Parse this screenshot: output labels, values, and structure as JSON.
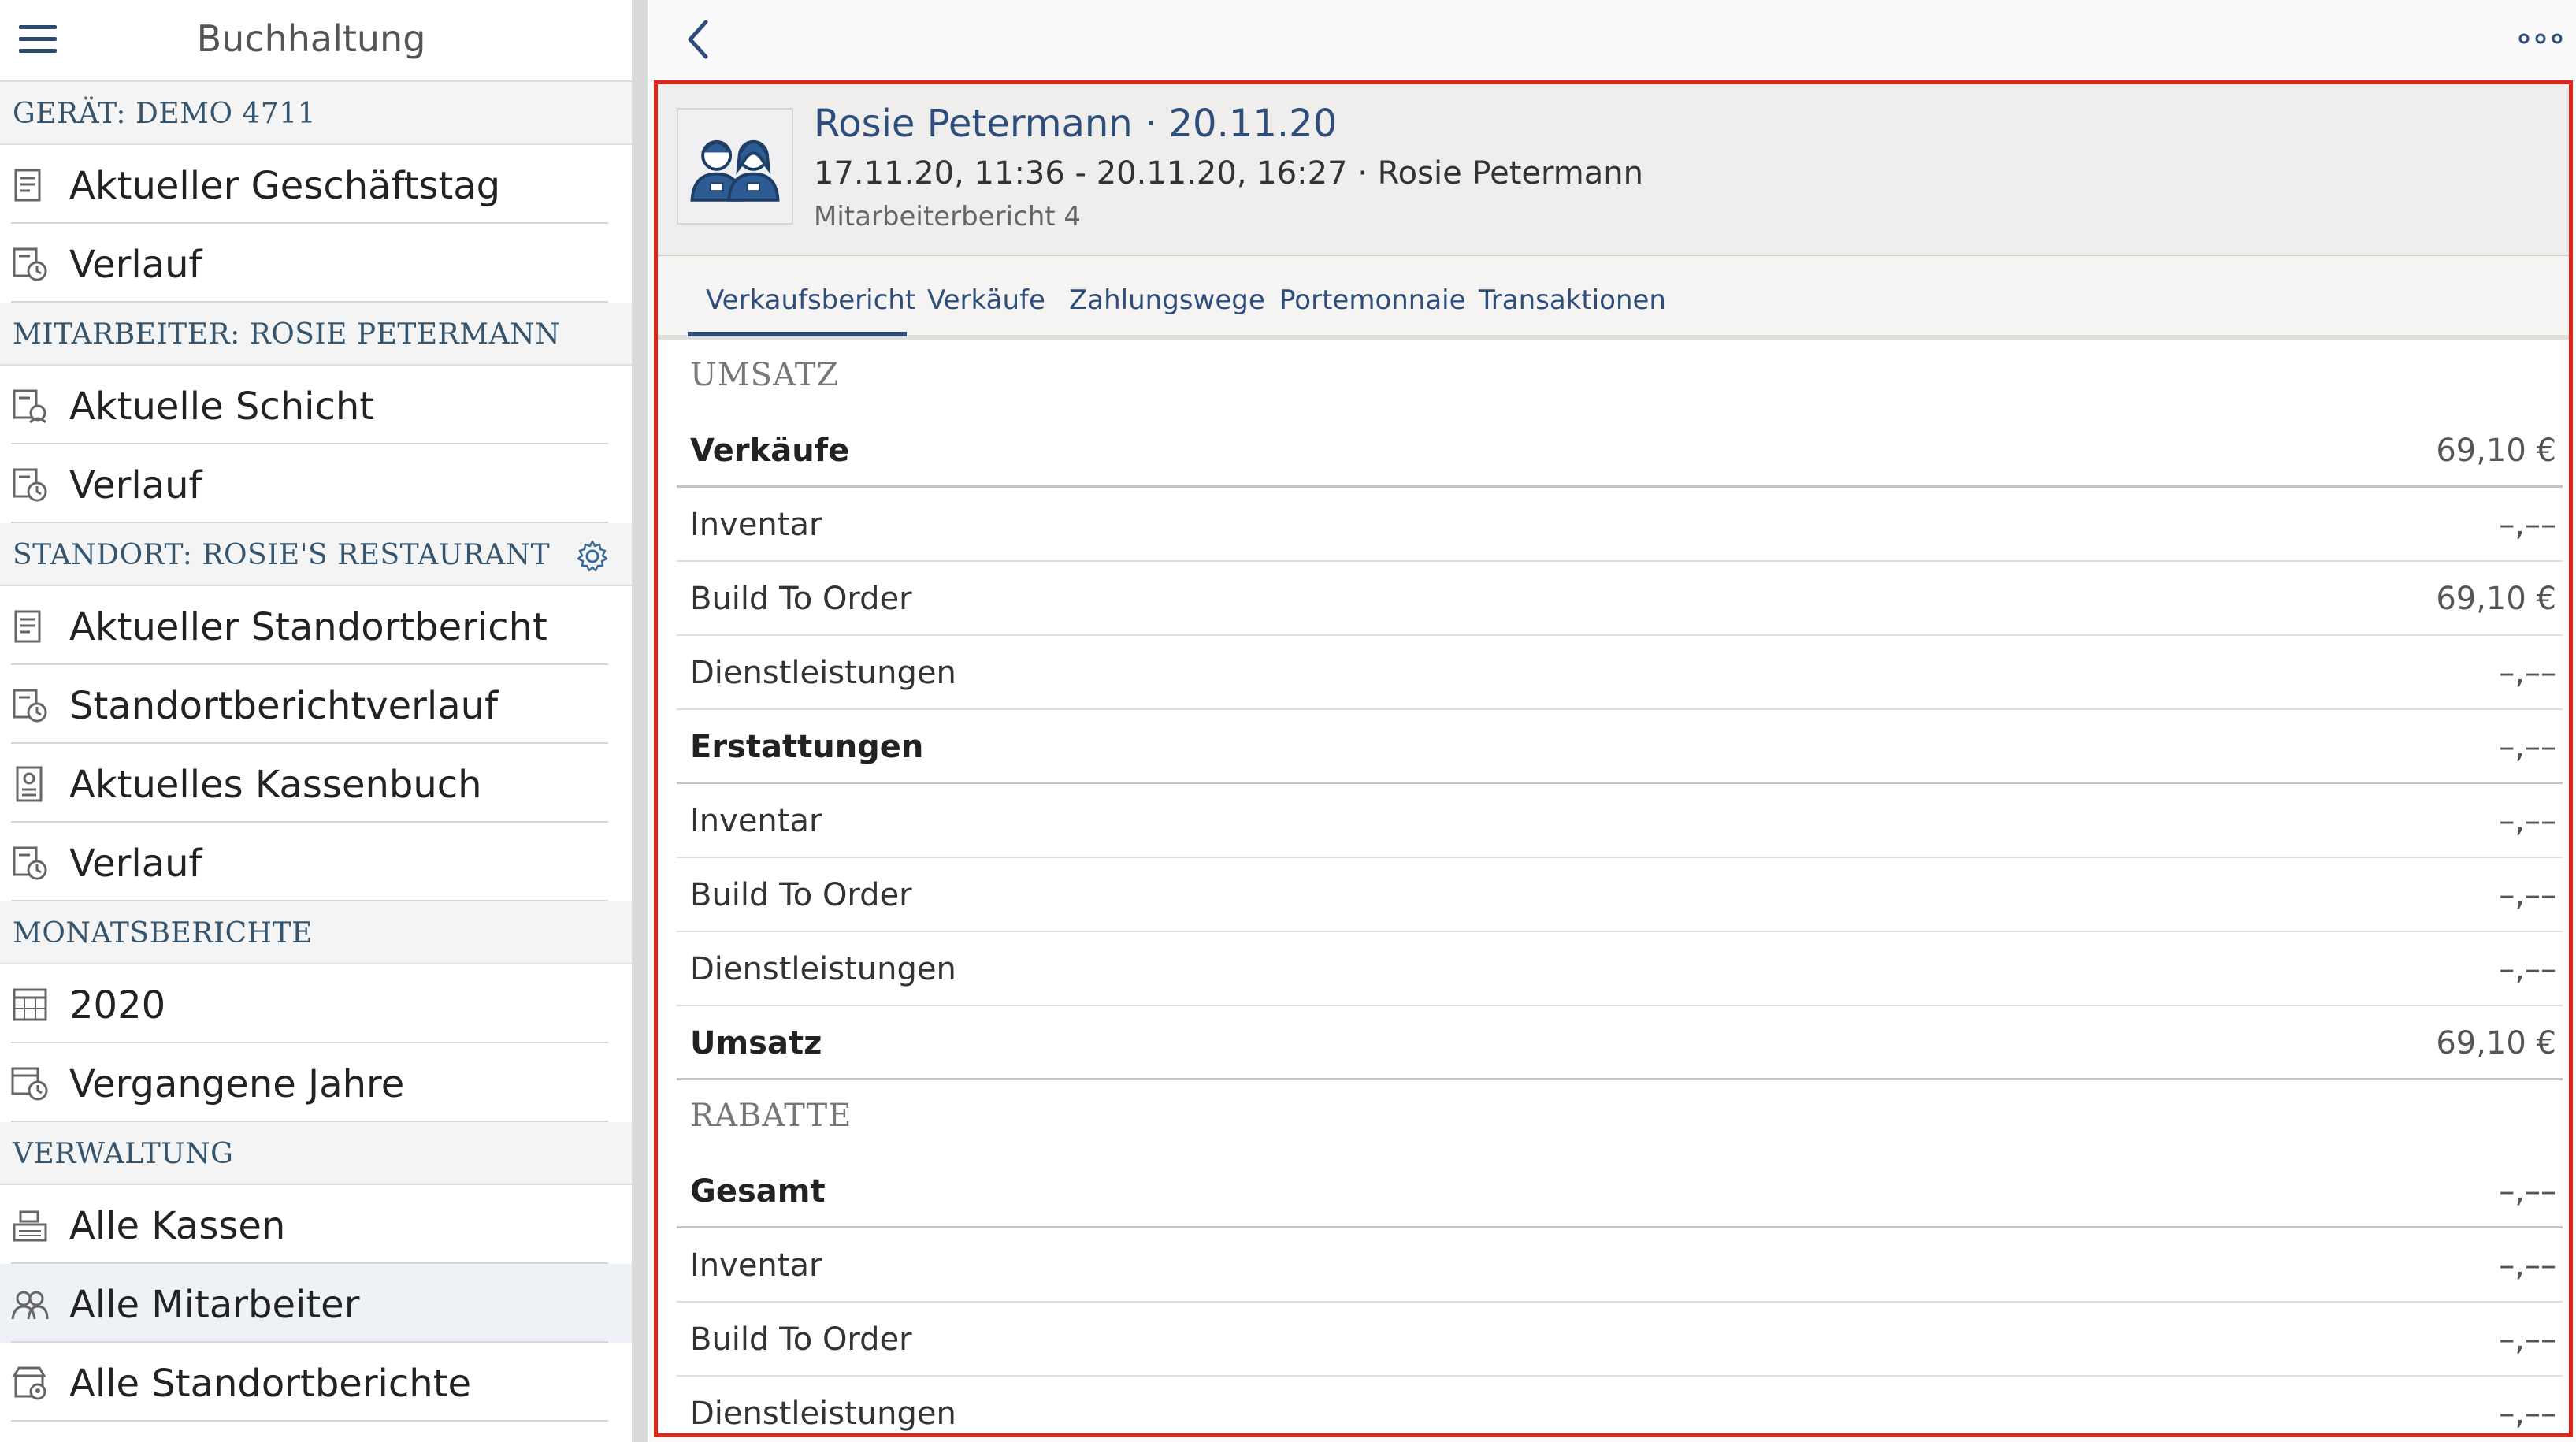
{
  "sidebar": {
    "title": "Buchhaltung",
    "sections": [
      {
        "label": "GERÄT: DEMO 4711",
        "gear": false,
        "items": [
          {
            "label": "Aktueller Geschäftstag",
            "icon": "receipt-icon",
            "active": false
          },
          {
            "label": "Verlauf",
            "icon": "history-receipt-icon",
            "active": false
          }
        ]
      },
      {
        "label": "MITARBEITER: ROSIE PETERMANN",
        "gear": false,
        "items": [
          {
            "label": "Aktuelle Schicht",
            "icon": "shift-receipt-icon",
            "active": false
          },
          {
            "label": "Verlauf",
            "icon": "history-receipt-icon",
            "active": false
          }
        ]
      },
      {
        "label": "STANDORT: ROSIE'S RESTAURANT",
        "gear": true,
        "items": [
          {
            "label": "Aktueller Standortbericht",
            "icon": "receipt-icon",
            "active": false
          },
          {
            "label": "Standortberichtverlauf",
            "icon": "history-receipt-icon",
            "active": false
          },
          {
            "label": "Aktuelles Kassenbuch",
            "icon": "cashbook-icon",
            "active": false
          },
          {
            "label": "Verlauf",
            "icon": "history-receipt-icon",
            "active": false
          }
        ]
      },
      {
        "label": "MONATSBERICHTE",
        "gear": false,
        "items": [
          {
            "label": "2020",
            "icon": "calendar-icon",
            "active": false
          },
          {
            "label": "Vergangene Jahre",
            "icon": "history-calendar-icon",
            "active": false
          }
        ]
      },
      {
        "label": "VERWALTUNG",
        "gear": false,
        "items": [
          {
            "label": "Alle Kassen",
            "icon": "cash-register-icon",
            "active": false
          },
          {
            "label": "Alle Mitarbeiter",
            "icon": "employees-icon",
            "active": true
          },
          {
            "label": "Alle Standortberichte",
            "icon": "store-location-icon",
            "active": false
          }
        ]
      }
    ]
  },
  "header": {
    "title": "Rosie Petermann · 20.11.20",
    "subtitle": "17.11.20, 11:36 - 20.11.20, 16:27 · Rosie Petermann",
    "report": "Mitarbeiterbericht 4"
  },
  "tabs": [
    "Verkaufsbericht",
    "Verkäufe",
    "Zahlungswege",
    "Portemonnaie",
    "Transaktionen"
  ],
  "active_tab": 0,
  "report": [
    {
      "type": "group",
      "label": "UMSATZ"
    },
    {
      "type": "row",
      "label": "Verkäufe",
      "value": "69,10 €",
      "bold": true
    },
    {
      "type": "row",
      "label": "Inventar",
      "value": "–,––",
      "bold": false
    },
    {
      "type": "row",
      "label": "Build To Order",
      "value": "69,10 €",
      "bold": false
    },
    {
      "type": "row",
      "label": "Dienstleistungen",
      "value": "–,––",
      "bold": false
    },
    {
      "type": "row",
      "label": "Erstattungen",
      "value": "–,––",
      "bold": true
    },
    {
      "type": "row",
      "label": "Inventar",
      "value": "–,––",
      "bold": false
    },
    {
      "type": "row",
      "label": "Build To Order",
      "value": "–,––",
      "bold": false
    },
    {
      "type": "row",
      "label": "Dienstleistungen",
      "value": "–,––",
      "bold": false
    },
    {
      "type": "row",
      "label": "Umsatz",
      "value": "69,10 €",
      "bold": true
    },
    {
      "type": "group",
      "label": "RABATTE"
    },
    {
      "type": "row",
      "label": "Gesamt",
      "value": "–,––",
      "bold": true
    },
    {
      "type": "row",
      "label": "Inventar",
      "value": "–,––",
      "bold": false
    },
    {
      "type": "row",
      "label": "Build To Order",
      "value": "–,––",
      "bold": false
    },
    {
      "type": "row",
      "label": "Dienstleistungen",
      "value": "–,––",
      "bold": false
    }
  ],
  "colors": {
    "accent": "#2d4e7c",
    "highlight_frame": "#e2231a",
    "section_text": "#35556e"
  }
}
